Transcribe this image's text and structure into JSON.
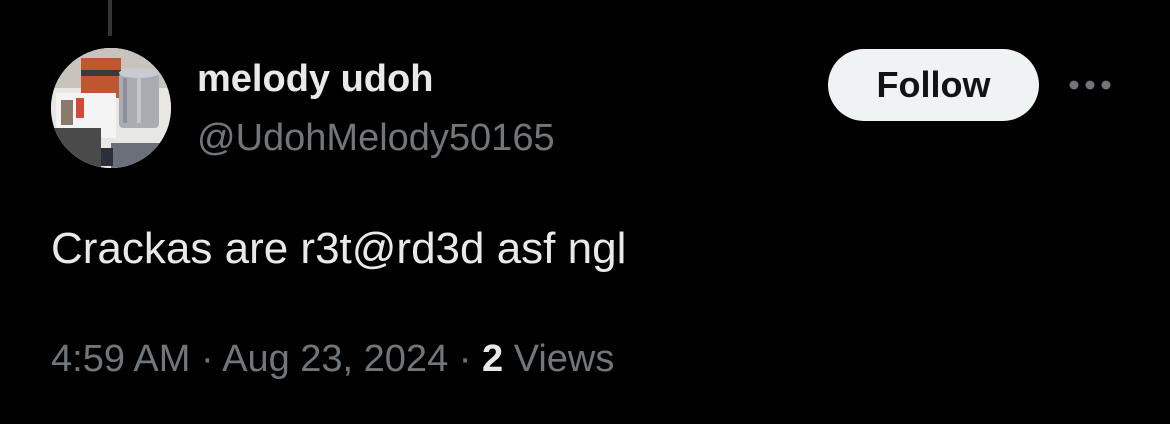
{
  "tweet": {
    "author": {
      "display_name": "melody udoh",
      "handle": "@UdohMelody50165"
    },
    "follow_label": "Follow",
    "more_icon": "more-horizontal-icon",
    "text": "Crackas are r3t@rd3d asf ngl",
    "time": "4:59 AM",
    "separator": "·",
    "date": "Aug 23, 2024",
    "views_count": "2",
    "views_label": "Views"
  },
  "colors": {
    "background": "#000000",
    "primary_text": "#e7e9ea",
    "secondary_text": "#71767b",
    "follow_button_bg": "#eff3f4",
    "follow_button_text": "#0f1419"
  }
}
